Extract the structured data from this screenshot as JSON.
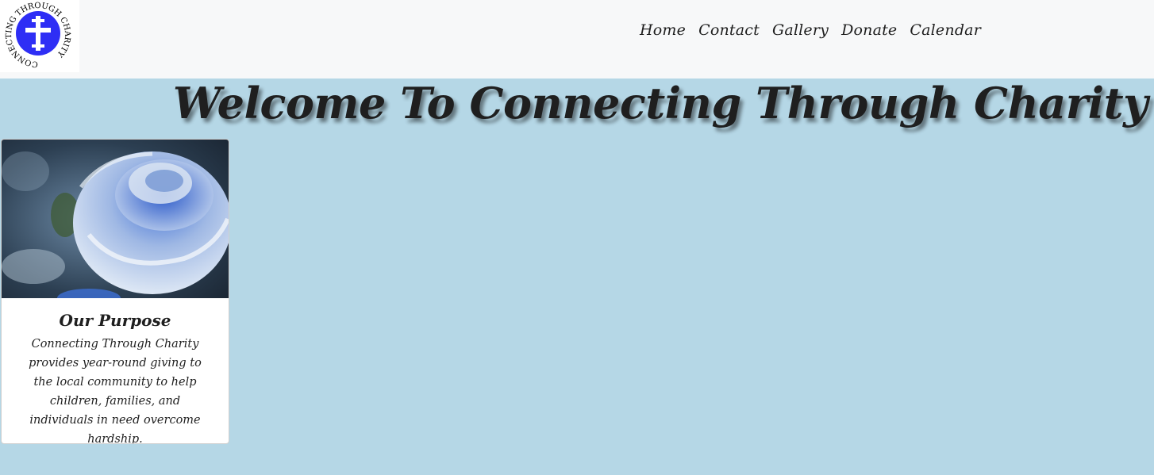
{
  "logo": {
    "alt": "Connecting Through Charity logo",
    "ring_text": "CONNECTING THROUGH CHARITY",
    "color": "#2e2ef5"
  },
  "nav": {
    "items": [
      {
        "label": "Home"
      },
      {
        "label": "Contact"
      },
      {
        "label": "Gallery"
      },
      {
        "label": "Donate"
      },
      {
        "label": "Calendar"
      }
    ]
  },
  "hero": {
    "title": "Welcome To Connecting Through Charity"
  },
  "purpose_card": {
    "image_alt": "Blue rose",
    "title": "Our Purpose",
    "text": "Connecting Through Charity provides year-round giving to the local community to help children, families, and individuals in need overcome hardship."
  },
  "colors": {
    "page_background": "#b5d7e6",
    "navbar_background": "#f7f8f9",
    "text": "#1f1f1f"
  }
}
